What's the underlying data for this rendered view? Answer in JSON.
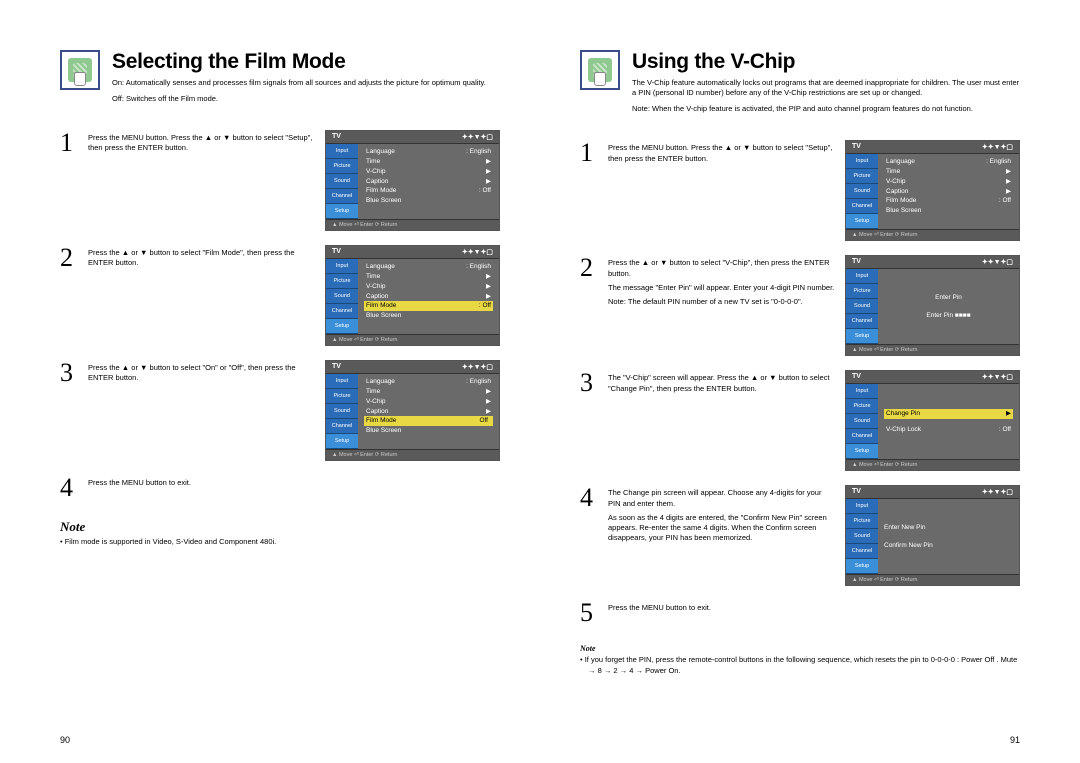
{
  "left": {
    "title": "Selecting the Film Mode",
    "intro1": "On: Automatically senses and processes film signals from all sources and adjusts the picture for optimum quality.",
    "intro2": "Off: Switches off the Film mode.",
    "steps": {
      "1": "Press the MENU button. Press the ▲ or ▼ button to select \"Setup\", then press the ENTER button.",
      "2": "Press the ▲ or ▼ button to select \"Film Mode\", then press the ENTER button.",
      "3": "Press the ▲ or ▼ button to select \"On\" or \"Off\", then press the ENTER button.",
      "4": "Press the MENU button to exit."
    },
    "noteHeading": "Note",
    "noteText": "Film mode is supported in Video, S-Video and Component 480i.",
    "pageNum": "90"
  },
  "right": {
    "title": "Using the V-Chip",
    "intro1": "The V-Chip feature automatically locks out programs that are deemed inappropriate for children. The user must enter a PIN (personal ID number) before any of the V-Chip restrictions are set up or changed.",
    "intro2": "Note: When the V-chip feature is activated, the PIP and auto channel program features do not function.",
    "steps": {
      "1": "Press the MENU button. Press the ▲ or ▼ button to select \"Setup\", then press the ENTER button.",
      "2": "Press the ▲ or ▼ button to select \"V-Chip\", then press the ENTER button.",
      "2b": "The message \"Enter Pin\" will appear. Enter your 4-digit PIN number.",
      "2c": "Note: The default PIN number of a new TV set is \"0-0-0-0\".",
      "3": "The \"V-Chip\" screen will appear. Press the ▲ or ▼ button to select \"Change Pin\", then press the ENTER button.",
      "4": "The Change pin screen will appear. Choose any 4-digits for your PIN and enter them.",
      "4b": "As soon as the 4 digits are entered, the \"Confirm New Pin\" screen appears. Re-enter the same 4 digits. When the Confirm screen disappears, your PIN has been memorized.",
      "5": "Press the MENU button to exit."
    },
    "noteHeading": "Note",
    "noteText": "If you forget the PIN, press the remote-control buttons in the following sequence, which resets the pin to 0-0-0-0 : Power Off .  Mute → 8 → 2 → 4 → Power On.",
    "pageNum": "91"
  },
  "tv": {
    "title": "TV",
    "tabs": [
      "Input",
      "Picture",
      "Sound",
      "Channel",
      "Setup"
    ],
    "setup": {
      "line1l": "Language",
      "line1r": ": English",
      "line2": "Time",
      "line3l": "V-Chip",
      "line3r": "▶",
      "line4l": "Caption",
      "line4r": "▶",
      "line5l": "Film Mode",
      "line5r": ": Off",
      "line6": "Blue Screen"
    },
    "vchip": {
      "enterPin": "Enter Pin",
      "pinField": "Enter Pin  ■■■■",
      "changePin": "Change Pin",
      "changePinR": "Enter New Pin",
      "confirm": "Confirm New Pin"
    },
    "footer": "▲ Move   ⏎ Enter   ⟳ Return"
  }
}
